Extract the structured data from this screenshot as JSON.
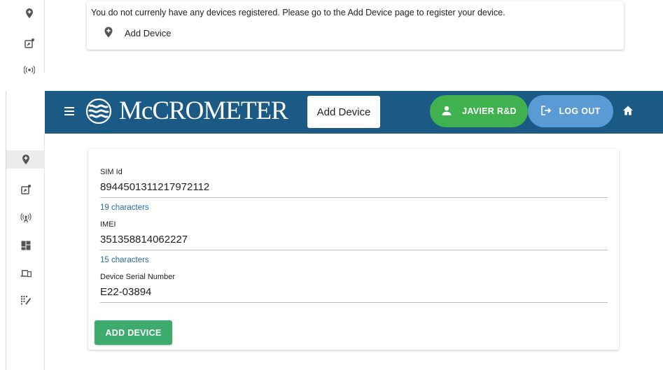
{
  "top": {
    "message": "You do not currenly have any devices registered. Please go to the Add Device page to register your device.",
    "add_device_link": "Add Device"
  },
  "header": {
    "brand": "McCROMETER",
    "page_title": "Add Device",
    "user_label": "JAVIER R&D",
    "logout_label": "LOG OUT"
  },
  "sidebar": {
    "items": [
      {
        "icon": "add-location-icon"
      },
      {
        "icon": "map-pin-icon"
      },
      {
        "icon": "signal-tower-icon"
      },
      {
        "icon": "dashboard-icon"
      },
      {
        "icon": "devices-icon"
      },
      {
        "icon": "tools-icon"
      }
    ]
  },
  "form": {
    "fields": [
      {
        "label": "SIM Id",
        "value": "8944501311217972112",
        "hint": "19 characters"
      },
      {
        "label": "IMEI",
        "value": "351358814062227",
        "hint": "15 characters"
      },
      {
        "label": "Device Serial Number",
        "value": "E22-03894"
      }
    ],
    "submit_label": "ADD DEVICE"
  },
  "colors": {
    "appbar": "#1a5a85",
    "user_button": "#3fb24f",
    "logout_button": "#5b9bd5",
    "submit_button": "#3daa6e",
    "hint_text": "#2a6da2"
  }
}
